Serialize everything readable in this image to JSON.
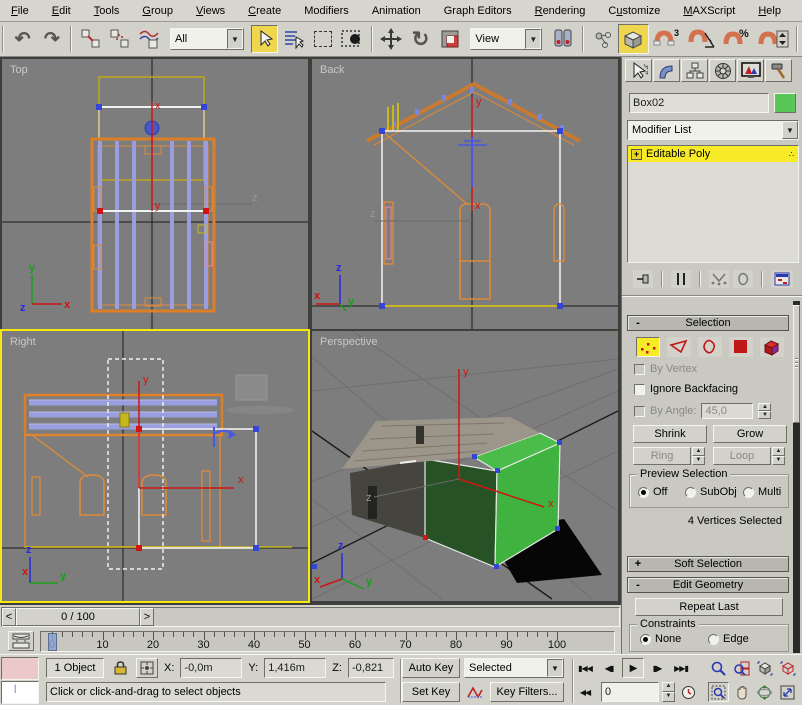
{
  "menu": {
    "items": [
      {
        "label": "File",
        "u": 0
      },
      {
        "label": "Edit",
        "u": 0
      },
      {
        "label": "Tools",
        "u": 0
      },
      {
        "label": "Group",
        "u": 0
      },
      {
        "label": "Views",
        "u": 0
      },
      {
        "label": "Create",
        "u": 0
      },
      {
        "label": "Modifiers",
        "u": -1
      },
      {
        "label": "Animation",
        "u": -1
      },
      {
        "label": "Graph Editors",
        "u": -1
      },
      {
        "label": "Rendering",
        "u": 0
      },
      {
        "label": "Customize",
        "u": 1
      },
      {
        "label": "MAXScript",
        "u": 0
      },
      {
        "label": "Help",
        "u": 0
      }
    ]
  },
  "toolbar": {
    "selection_filter": "All",
    "coord_system": "View",
    "undo_glyph": "↶",
    "redo_glyph": "↷",
    "rotate_glyph": "↻"
  },
  "axis": {
    "x": "x",
    "y": "y",
    "z": "z"
  },
  "viewports": {
    "top": "Top",
    "back": "Back",
    "right": "Right",
    "perspective": "Perspective"
  },
  "timeline": {
    "slider_value": "0 / 100",
    "prev": "<",
    "next": ">",
    "ticks": [
      0,
      10,
      20,
      30,
      40,
      50,
      60,
      70,
      80,
      90,
      100
    ],
    "frame_start": 0,
    "frame_end": 100,
    "current_frame": 0
  },
  "command_panel": {
    "object_name": "Box02",
    "object_color": "#57c857",
    "modifier_list_label": "Modifier List",
    "stack_item": "Editable Poly",
    "selection": {
      "title": "Selection",
      "by_vertex": "By Vertex",
      "ignore_backfacing": "Ignore Backfacing",
      "by_angle": "By Angle:",
      "by_angle_value": "45,0",
      "shrink": "Shrink",
      "grow": "Grow",
      "ring": "Ring",
      "loop": "Loop",
      "preview_title": "Preview Selection",
      "off": "Off",
      "subobj": "SubObj",
      "multi": "Multi",
      "status": "4 Vertices Selected"
    },
    "soft_selection_title": "Soft Selection",
    "edit_geometry_title": "Edit Geometry",
    "repeat_last": "Repeat Last",
    "constraints": {
      "title": "Constraints",
      "none": "None",
      "edge": "Edge"
    }
  },
  "ui": {
    "minus": "-",
    "plus": "+"
  },
  "status_bar": {
    "object_count": "1 Object",
    "x_label": "X:",
    "x_value": "-0,0m",
    "y_label": "Y:",
    "y_value": "1,416m",
    "z_label": "Z:",
    "z_value": "-0,821",
    "prompt": "Click or click-and-drag to select objects",
    "auto_key": "Auto Key",
    "set_key": "Set Key",
    "key_filter_dropdown": "Selected",
    "key_filters": "Key Filters...",
    "frame_value": "0",
    "playback": {
      "go_start": "▮◀◀",
      "prev": "◀▮",
      "play": "▶",
      "next": "▮▶",
      "go_end": "▶▶▮",
      "key_mode": "◀◀"
    }
  }
}
